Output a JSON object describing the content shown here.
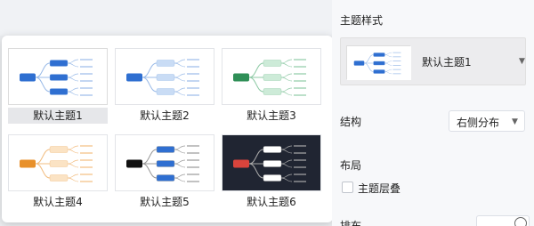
{
  "themes": [
    {
      "label": "默认主题1",
      "root_color": "#2f6fd1",
      "branch_color": "#2f6fd1",
      "bg": "#ffffff",
      "line": "#9bbbe8"
    },
    {
      "label": "默认主题2",
      "root_color": "#2f6fd1",
      "branch_color": "#c9dcf5",
      "bg": "#ffffff",
      "line": "#9bbbe8"
    },
    {
      "label": "默认主题3",
      "root_color": "#2f8f57",
      "branch_color": "#cdebd8",
      "bg": "#ffffff",
      "line": "#8fcaa6"
    },
    {
      "label": "默认主题4",
      "root_color": "#e8902a",
      "branch_color": "#fbe3c4",
      "bg": "#ffffff",
      "line": "#f2bd80"
    },
    {
      "label": "默认主题5",
      "root_color": "#111111",
      "branch_color": "#2f6fd1",
      "bg": "#ffffff",
      "line": "#999999"
    },
    {
      "label": "默认主题6",
      "root_color": "#d9443c",
      "branch_color": "#ffffff",
      "bg": "#202532",
      "line": "#aaaaaa"
    }
  ],
  "selected_theme_index": 0,
  "panel": {
    "theme_style_title": "主题样式",
    "current_theme": "默认主题1",
    "structure_label": "结构",
    "structure_value": "右侧分布",
    "layout_title": "布局",
    "theme_overlap_label": "主题层叠",
    "cut_label": "排布"
  }
}
